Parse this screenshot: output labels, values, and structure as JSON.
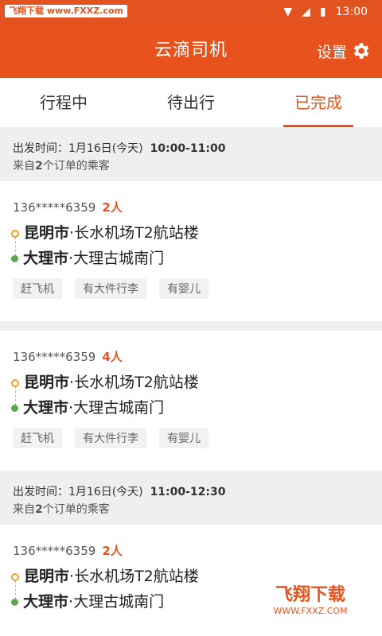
{
  "status_bar": {
    "watermark": "飞翔下载 www.FXXZ.com",
    "time": "13:00"
  },
  "app_bar": {
    "title": "云滴司机",
    "settings_label": "设置"
  },
  "tabs": [
    {
      "label": "行程中",
      "active": false
    },
    {
      "label": "待出行",
      "active": false
    },
    {
      "label": "已完成",
      "active": true
    }
  ],
  "groups": [
    {
      "depart_label": "出发时间：",
      "date": "1月16日(今天)",
      "time_range": "10:00-11:00",
      "from_orders_prefix": "来自",
      "order_count": "2",
      "from_orders_suffix": "个订单的乘客",
      "orders": [
        {
          "phone": "136*****6359",
          "people": "2人",
          "from_city": "昆明市",
          "from_place": "长水机场T2航站楼",
          "to_city": "大理市",
          "to_place": "大理古城南门",
          "tags": [
            "赶飞机",
            "有大件行李",
            "有婴儿"
          ]
        },
        {
          "phone": "136*****6359",
          "people": "4人",
          "from_city": "昆明市",
          "from_place": "长水机场T2航站楼",
          "to_city": "大理市",
          "to_place": "大理古城南门",
          "tags": [
            "赶飞机",
            "有大件行李",
            "有婴儿"
          ]
        }
      ]
    },
    {
      "depart_label": "出发时间：",
      "date": "1月16日(今天)",
      "time_range": "11:00-12:30",
      "from_orders_prefix": "来自",
      "order_count": "2",
      "from_orders_suffix": "个订单的乘客",
      "orders": [
        {
          "phone": "136*****6359",
          "people": "2人",
          "from_city": "昆明市",
          "from_place": "长水机场T2航站楼",
          "to_city": "大理市",
          "to_place": "大理古城南门"
        }
      ]
    }
  ],
  "route_separator": "·",
  "bottom_watermark": {
    "logo": "飞翔下载",
    "url": "WWW.FXXZ.COM"
  },
  "colors": {
    "accent": "#e8531d",
    "status_bar": "#e2531f",
    "origin_dot": "#f0a020",
    "dest_dot": "#5aa84e"
  }
}
